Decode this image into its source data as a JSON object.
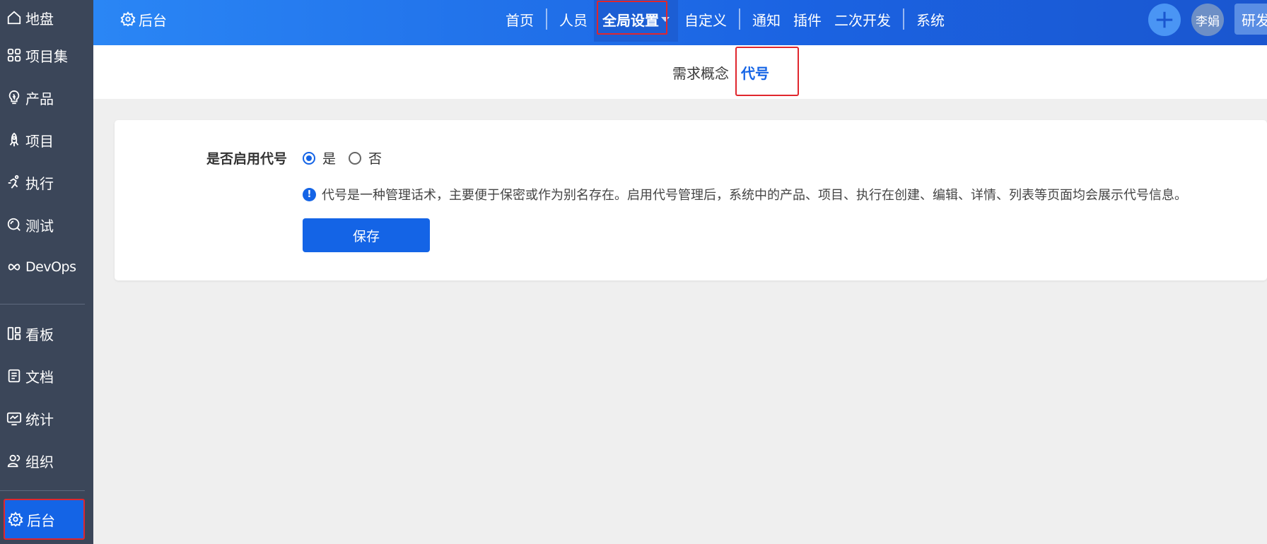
{
  "sidebar": {
    "items": [
      {
        "label": "地盘",
        "icon": "home-icon"
      },
      {
        "label": "项目集",
        "icon": "grid-icon"
      },
      {
        "label": "产品",
        "icon": "bulb-icon"
      },
      {
        "label": "项目",
        "icon": "rocket-icon"
      },
      {
        "label": "执行",
        "icon": "run-icon"
      },
      {
        "label": "测试",
        "icon": "search-icon"
      },
      {
        "label": "DevOps",
        "icon": "infinity-icon"
      },
      {
        "label": "看板",
        "icon": "kanban-icon"
      },
      {
        "label": "文档",
        "icon": "doc-icon"
      },
      {
        "label": "统计",
        "icon": "chart-icon"
      },
      {
        "label": "组织",
        "icon": "users-icon"
      },
      {
        "label": "后台",
        "icon": "gear-icon"
      }
    ]
  },
  "header": {
    "brand": "后台",
    "nav": [
      "首页",
      "人员",
      "全局设置",
      "自定义",
      "通知",
      "插件",
      "二次开发",
      "系统"
    ],
    "avatar": "李娟",
    "rnd_button": "研发"
  },
  "subnav": {
    "tabs": [
      "需求概念",
      "代号"
    ]
  },
  "form": {
    "label": "是否启用代号",
    "options": [
      "是",
      "否"
    ],
    "selected": "是",
    "hint": "代号是一种管理话术，主要便于保密或作为别名存在。启用代号管理后，系统中的产品、项目、执行在创建、编辑、详情、列表等页面均会展示代号信息。",
    "save": "保存"
  },
  "colors": {
    "primary": "#1464e6",
    "sidebar": "#3b4659",
    "highlight": "#e0262d"
  }
}
